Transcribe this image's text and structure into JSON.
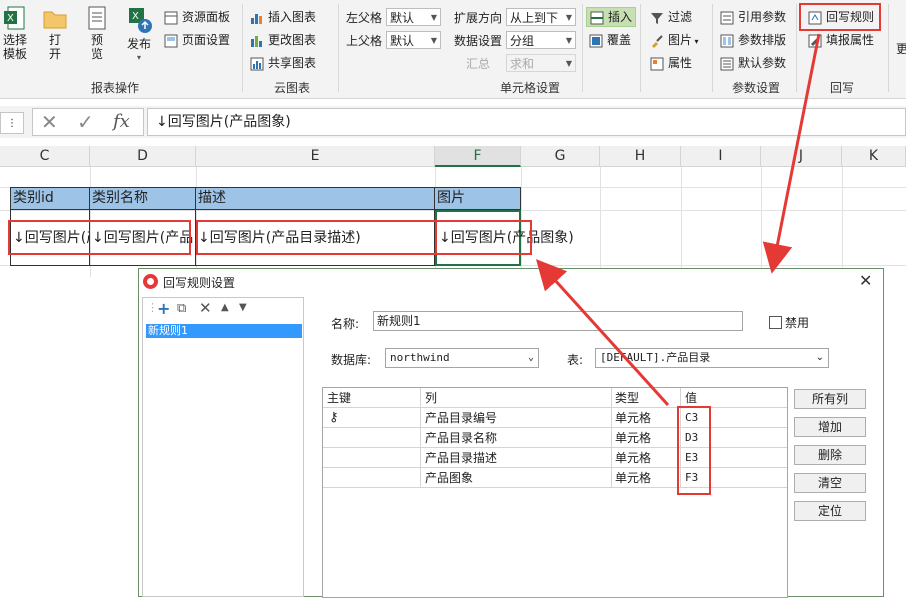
{
  "ribbon": {
    "report_ops": {
      "select_template": "选择\n模板",
      "open": "打\n开",
      "preview": "预\n览",
      "publish": "发布",
      "label": "报表操作"
    },
    "resource_panel": "资源面板",
    "page_setup": "页面设置",
    "cloud_chart": {
      "insert_chart": "插入图表",
      "change_chart": "更改图表",
      "share_chart": "共享图表",
      "label": "云图表"
    },
    "cell_settings": {
      "left_parent_label": "左父格",
      "left_parent_value": "默认",
      "upper_parent_label": "上父格",
      "upper_parent_value": "默认",
      "expand_dir_label": "扩展方向",
      "expand_dir_value": "从上到下",
      "data_setting_label": "数据设置",
      "data_setting_value": "分组",
      "summary_label": "汇总",
      "summary_value": "求和",
      "label": "单元格设置"
    },
    "insert": "插入",
    "overwrite": "覆盖",
    "filter": "过滤",
    "picture": "图片",
    "attribute": "属性",
    "params": {
      "ref_params": "引用参数",
      "param_layout": "参数排版",
      "default_params": "默认参数",
      "label": "参数设置"
    },
    "writeback": {
      "writeback_rule": "回写规则",
      "fill_attr": "填报属性",
      "label": "回写"
    }
  },
  "formula_bar": {
    "fx": "fx",
    "content": "↓回写图片(产品图象)"
  },
  "columns": [
    "C",
    "D",
    "E",
    "F",
    "G",
    "H",
    "I",
    "J",
    "K"
  ],
  "header_row": [
    "类别id",
    "类别名称",
    "描述",
    "图片"
  ],
  "data_row": [
    "↓回写图片(产",
    "↓回写图片(产品",
    "↓回写图片(产品目录描述)",
    "↓回写图片(产品图象)"
  ],
  "dialog": {
    "title": "回写规则设置",
    "rule_item": "新规则1",
    "name_label": "名称:",
    "name_value": "新规则1",
    "disable_label": "禁用",
    "db_label": "数据库:",
    "db_value": "northwind",
    "table_label": "表:",
    "table_value": "[DEFAULT].产品目录",
    "table_headers": [
      "主键",
      "列",
      "类型",
      "值"
    ],
    "rows": [
      {
        "col": "产品目录编号",
        "type": "单元格",
        "value": "C3"
      },
      {
        "col": "产品目录名称",
        "type": "单元格",
        "value": "D3"
      },
      {
        "col": "产品目录描述",
        "type": "单元格",
        "value": "E3"
      },
      {
        "col": "产品图象",
        "type": "单元格",
        "value": "F3"
      }
    ],
    "buttons": [
      "所有列",
      "增加",
      "删除",
      "清空",
      "定位"
    ]
  },
  "colors": {
    "accent_red": "#e53935",
    "excel_green": "#217346",
    "header_blue": "#9dc3e6",
    "selection_blue": "#3399ff"
  }
}
